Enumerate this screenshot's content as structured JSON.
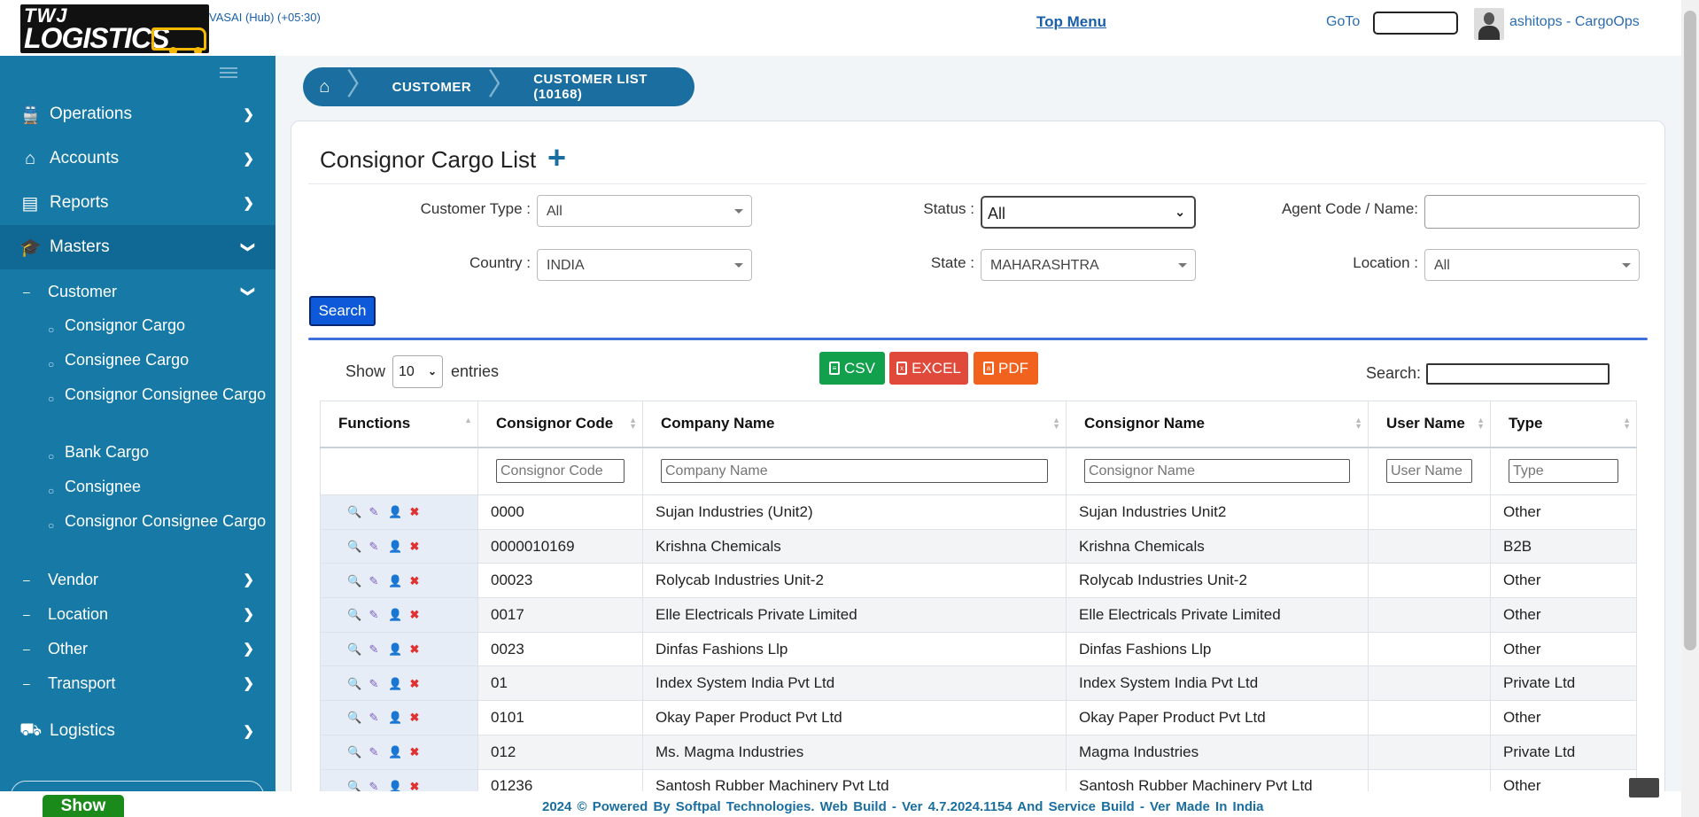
{
  "header": {
    "logo_line1": "TWJ",
    "logo_line2": "LOGISTICS",
    "hub": "VASAI (Hub) (+05:30)",
    "top_menu": "Top Menu",
    "goto": "GoTo",
    "user": "ashitops - CargoOps"
  },
  "sidebar": {
    "items": [
      {
        "label": "Operations"
      },
      {
        "label": "Accounts"
      },
      {
        "label": "Reports"
      },
      {
        "label": "Masters"
      },
      {
        "label": "Logistics"
      }
    ],
    "masters_sub": [
      {
        "label": "Customer"
      },
      {
        "label": "Vendor"
      },
      {
        "label": "Location"
      },
      {
        "label": "Other"
      },
      {
        "label": "Transport"
      }
    ],
    "customer_leaves": [
      {
        "label": "Consignor Cargo"
      },
      {
        "label": "Consignee Cargo"
      },
      {
        "label": "Consignor Consignee Cargo"
      },
      {
        "label": "Bank Cargo"
      },
      {
        "label": "Consignee"
      },
      {
        "label": "Consignor Consignee Cargo"
      }
    ]
  },
  "breadcrumb": {
    "level1": "CUSTOMER",
    "level2": "CUSTOMER LIST (10168)"
  },
  "page": {
    "title": "Consignor Cargo List"
  },
  "filters": {
    "customer_type_label": "Customer Type :",
    "customer_type_value": "All",
    "status_label": "Status :",
    "status_value": "All",
    "agent_label": "Agent Code / Name:",
    "agent_value": "",
    "country_label": "Country :",
    "country_value": "INDIA",
    "state_label": "State :",
    "state_value": "MAHARASHTRA",
    "location_label": "Location :",
    "location_value": "All",
    "search_button": "Search"
  },
  "table_controls": {
    "show_label": "Show",
    "entries_value": "10",
    "entries_label": "entries",
    "csv": "CSV",
    "excel": "EXCEL",
    "pdf": "PDF",
    "search_label": "Search:"
  },
  "table": {
    "headers": [
      "Functions",
      "Consignor Code",
      "Company Name",
      "Consignor Name",
      "User Name",
      "Type"
    ],
    "filter_placeholders": [
      "Consignor Code",
      "Company Name",
      "Consignor Name",
      "User Name",
      "Type"
    ],
    "rows": [
      {
        "code": "0000",
        "company": "Sujan Industries (Unit2)",
        "consignor": "Sujan Industries Unit2",
        "user": "",
        "type": "Other"
      },
      {
        "code": "0000010169",
        "company": "Krishna Chemicals",
        "consignor": "Krishna Chemicals",
        "user": "",
        "type": "B2B"
      },
      {
        "code": "00023",
        "company": "Rolycab Industries Unit-2",
        "consignor": "Rolycab Industries Unit-2",
        "user": "",
        "type": "Other"
      },
      {
        "code": "0017",
        "company": "Elle Electricals Private Limited",
        "consignor": "Elle Electricals Private Limited",
        "user": "",
        "type": "Other"
      },
      {
        "code": "0023",
        "company": "Dinfas Fashions Llp",
        "consignor": "Dinfas Fashions Llp",
        "user": "",
        "type": "Other"
      },
      {
        "code": "01",
        "company": "Index System India Pvt Ltd",
        "consignor": "Index System India Pvt Ltd",
        "user": "",
        "type": "Private Ltd"
      },
      {
        "code": "0101",
        "company": "Okay Paper Product Pvt Ltd",
        "consignor": "Okay Paper Product Pvt Ltd",
        "user": "",
        "type": "Other"
      },
      {
        "code": "012",
        "company": "Ms. Magma Industries",
        "consignor": "Magma Industries",
        "user": "",
        "type": "Private Ltd"
      },
      {
        "code": "01236",
        "company": "Santosh Rubber Machinery Pvt Ltd",
        "consignor": "Santosh Rubber Machinery Pvt Ltd",
        "user": "",
        "type": "Other"
      }
    ]
  },
  "footer": {
    "text": "2024 © Powered By Softpal Technologies.   Web Build - Ver 4.7.2024.1154  And Service Build - Ver   Made In India",
    "show_button": "Show"
  },
  "icons": {
    "home": "home-icon",
    "add": "plus-icon",
    "view": "magnifier-icon",
    "edit": "pencil-icon",
    "user": "user-icon",
    "delete": "delete-x-icon"
  },
  "colors": {
    "sidebar": "#1679a6",
    "breadcrumb": "#1a6ea0",
    "csv": "#13a04d",
    "excel": "#e04a3a",
    "pdf": "#f2621f",
    "search_btn": "#0d59d9"
  }
}
